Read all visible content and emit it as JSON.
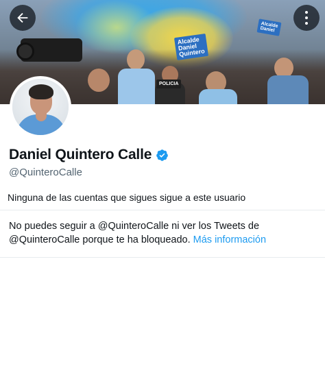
{
  "banner": {
    "sign_lines": [
      "Alcalde",
      "Daniel",
      "Quintero"
    ],
    "police_label": "POLICIA"
  },
  "profile": {
    "display_name": "Daniel Quintero Calle",
    "handle": "@QuinteroCalle",
    "verified": true,
    "accent_color": "#1d9bf0"
  },
  "follow_note": "Ninguna de las cuentas que sigues sigue a este usuario",
  "blocked": {
    "message": "No puedes seguir a @QuinteroCalle ni ver los Tweets de @QuinteroCalle porque te ha bloqueado.",
    "link_label": "Más información"
  },
  "icons": {
    "back": "back-arrow-icon",
    "more": "more-vertical-icon",
    "verified": "verified-badge-icon"
  }
}
